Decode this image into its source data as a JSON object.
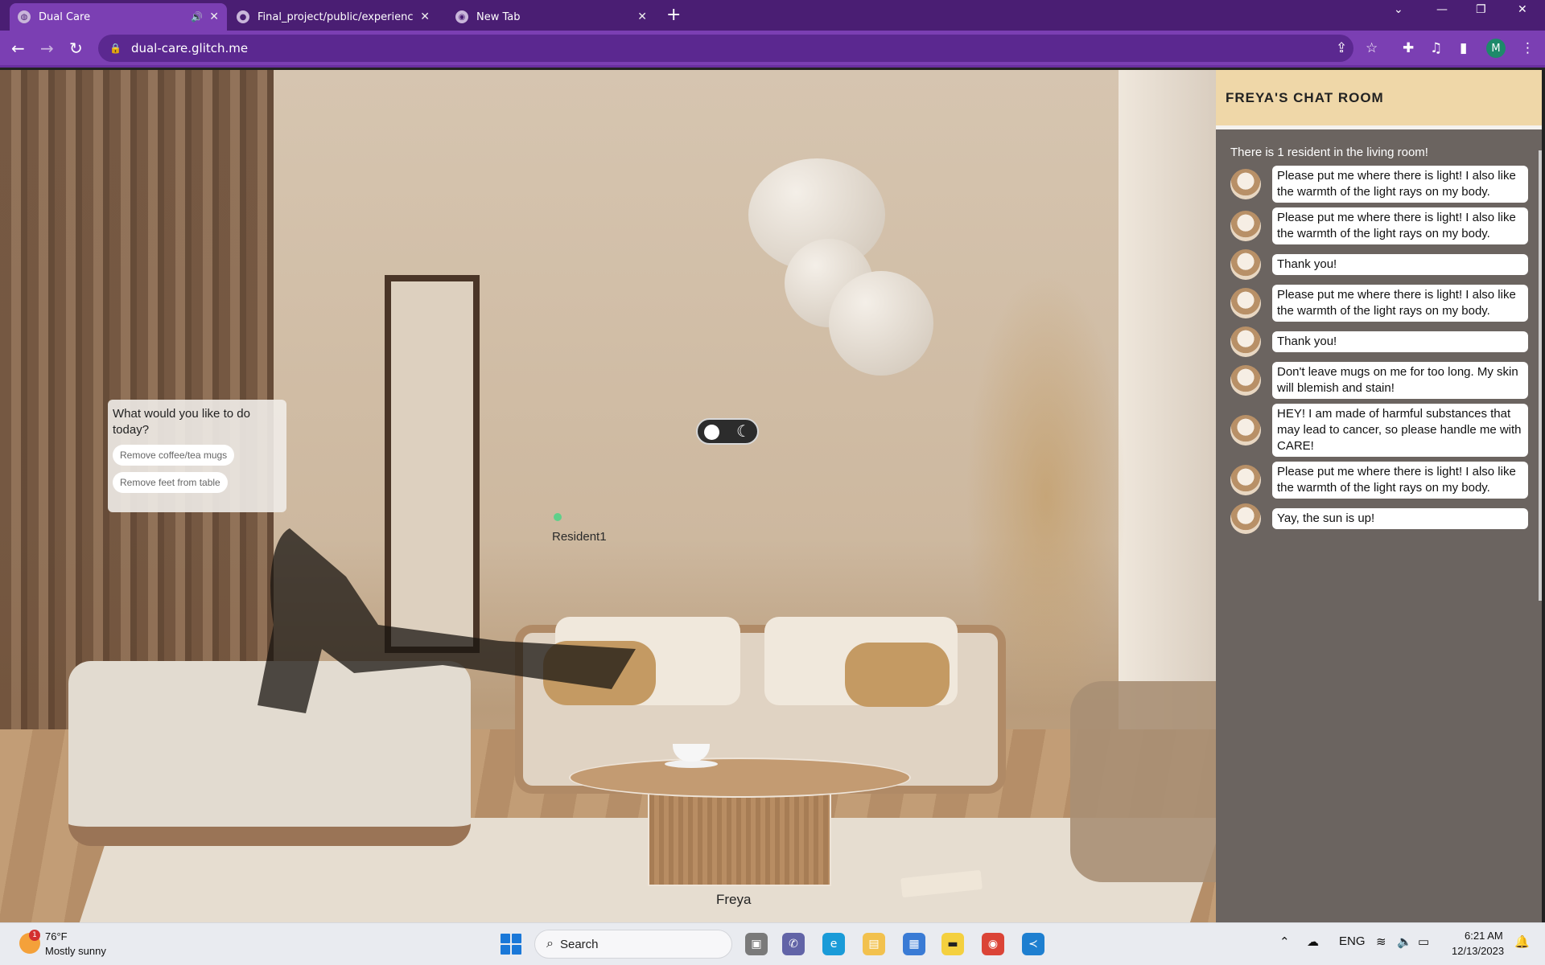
{
  "browser": {
    "tabs": [
      {
        "title": "Dual Care",
        "active": true
      },
      {
        "title": "Final_project/public/experience",
        "active": false
      },
      {
        "title": "New Tab",
        "active": false
      }
    ],
    "url": "dual-care.glitch.me",
    "profile_initial": "M",
    "accent_color": "#7b3fb3"
  },
  "scene": {
    "menu": {
      "question": "What would you like to do today?",
      "options": [
        "Remove coffee/tea mugs",
        "Remove feet from table"
      ]
    },
    "resident_label": "Resident1",
    "object_label": "Freya",
    "toggle_icons": [
      "sun-icon",
      "moon-icon"
    ]
  },
  "chat": {
    "title": "FREYA'S CHAT ROOM",
    "count_text": "There is 1 resident in the living room!",
    "messages": [
      "Please put me where there is light! I also like the warmth of the light rays on my body.",
      "Please put me where there is light! I also like the warmth of the light rays on my body.",
      "Thank you!",
      "Please put me where there is light! I also like the warmth of the light rays on my body.",
      "Thank you!",
      "Don't leave mugs on me for too long. My skin will blemish and stain!",
      "HEY! I am made of harmful substances that may lead to cancer, so please handle me with CARE!",
      "Please put me where there is light! I also like the warmth of the light rays on my body.",
      "Yay, the sun is up!"
    ]
  },
  "taskbar": {
    "weather_temp": "76°F",
    "weather_desc": "Mostly sunny",
    "weather_badge": "1",
    "search_label": "Search",
    "lang": "ENG",
    "time": "6:21 AM",
    "date": "12/13/2023"
  }
}
